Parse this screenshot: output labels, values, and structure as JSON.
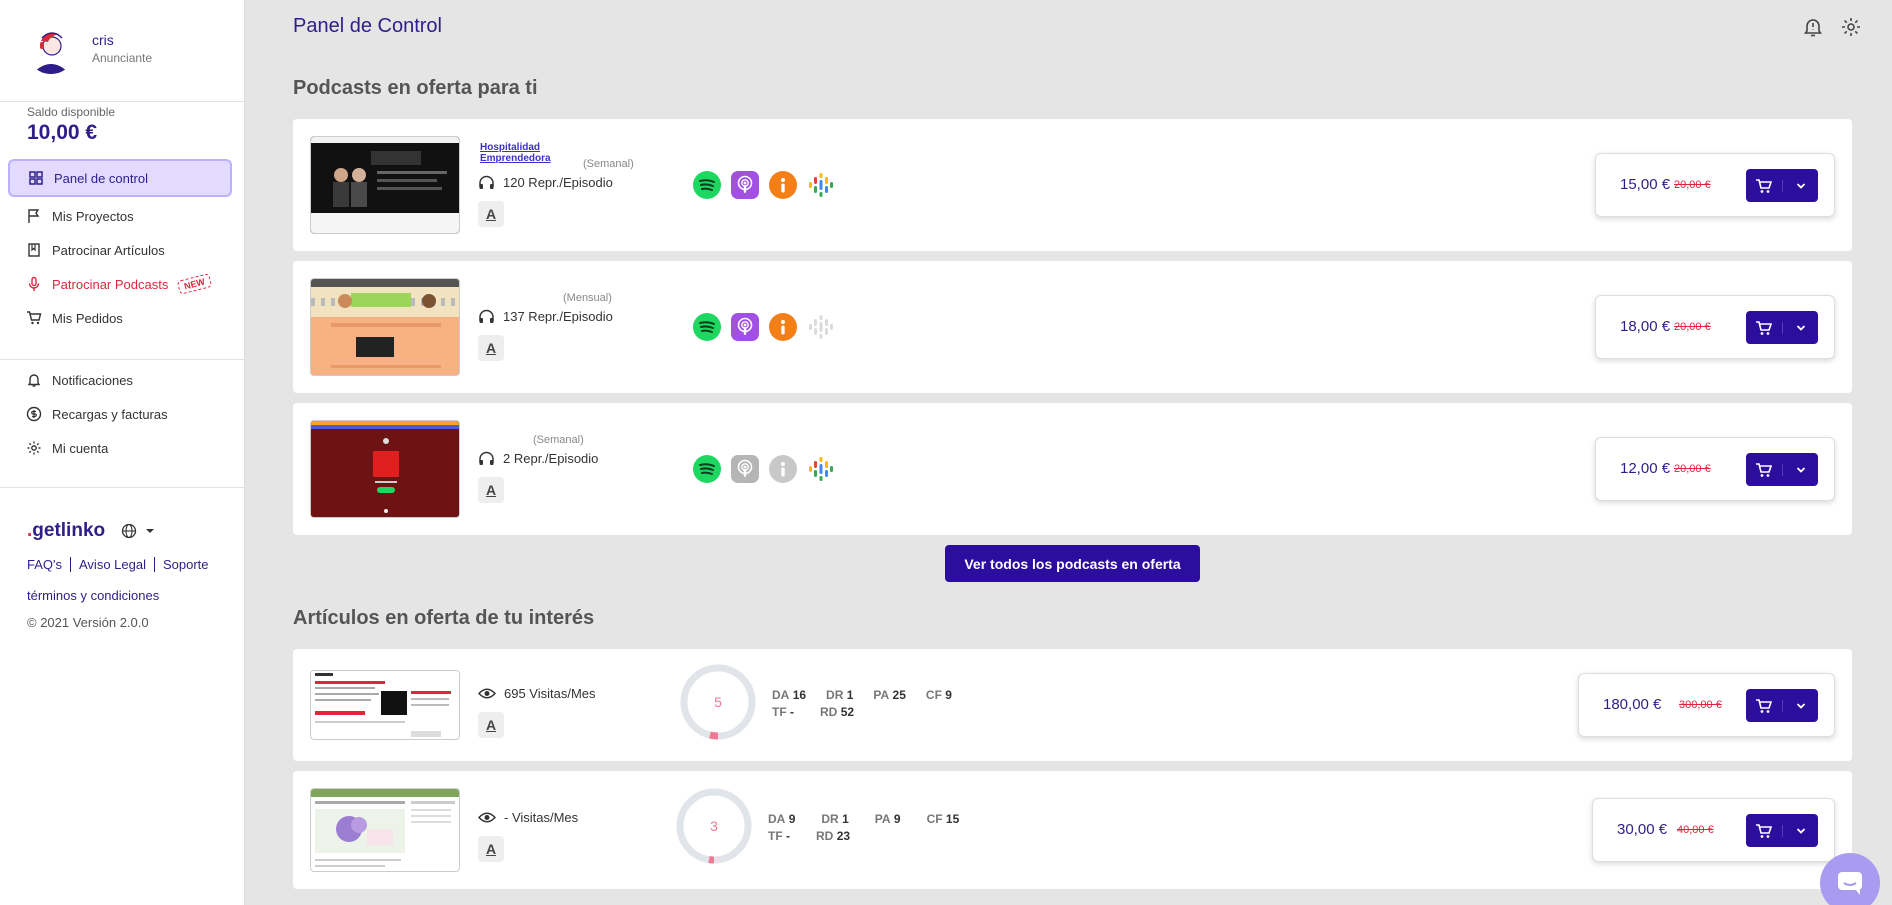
{
  "user": {
    "name": "cris",
    "role": "Anunciante"
  },
  "balance": {
    "label": "Saldo disponible",
    "value": "10,00 €"
  },
  "nav": [
    {
      "label": "Panel de control"
    },
    {
      "label": "Mis Proyectos"
    },
    {
      "label": "Patrocinar Artículos"
    },
    {
      "label": "Patrocinar Podcasts",
      "badge": "NEW"
    },
    {
      "label": "Mis Pedidos"
    },
    {
      "label": "Notificaciones"
    },
    {
      "label": "Recargas y facturas"
    },
    {
      "label": "Mi cuenta"
    }
  ],
  "brand": "getlinko",
  "footer": {
    "links": [
      "FAQ's",
      "Aviso Legal",
      "Soporte"
    ],
    "terms": "términos y condiciones",
    "copyright": "© 2021 Versión 2.0.0"
  },
  "page_title": "Panel de Control",
  "podcasts_section": {
    "title": "Podcasts en oferta para ti",
    "items": [
      {
        "name": "Hospitalidad Emprendedora",
        "frequency": "(Semanal)",
        "metric": "120 Repr./Episodio",
        "price": "15,00 €",
        "old_price": "20,00 €"
      },
      {
        "name": "",
        "frequency": "(Mensual)",
        "metric": "137 Repr./Episodio",
        "price": "18,00 €",
        "old_price": "20,00 €"
      },
      {
        "name": "",
        "frequency": "(Semanal)",
        "metric": "2 Repr./Episodio",
        "price": "12,00 €",
        "old_price": "20,00 €"
      }
    ],
    "view_all": "Ver todos los podcasts en oferta"
  },
  "articles_section": {
    "title": "Artículos en oferta de tu interés",
    "items": [
      {
        "metric": "695 Visitas/Mes",
        "score": "5",
        "da": "16",
        "dr": "1",
        "pa": "25",
        "cf": "9",
        "tf": "-",
        "rd": "52",
        "price": "180,00 €",
        "old_price": "300,00 €"
      },
      {
        "metric": "- Visitas/Mes",
        "score": "3",
        "da": "9",
        "dr": "1",
        "pa": "9",
        "cf": "15",
        "tf": "-",
        "rd": "23",
        "price": "30,00 €",
        "old_price": "40,00 €"
      }
    ]
  },
  "stat_labels": {
    "da": "DA",
    "dr": "DR",
    "pa": "PA",
    "cf": "CF",
    "tf": "TF",
    "rd": "RD"
  },
  "colors": {
    "primary": "#2d0d9e",
    "accent": "#e0253f",
    "active_bg": "#e2dbff"
  }
}
